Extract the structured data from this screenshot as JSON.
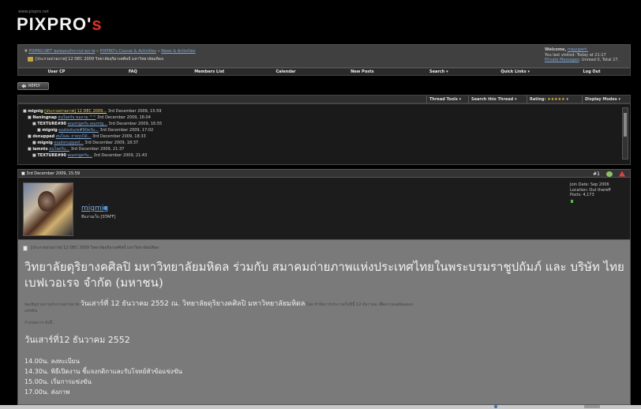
{
  "site": {
    "url": "www.pixpro.net",
    "logo_main": "PIXPRO'",
    "logo_accent": "s"
  },
  "breadcrumb": {
    "lead_symbol": "▼",
    "items": [
      "PIXPRO.NET ชุมชนคนรักการถ่ายภาพ",
      "PIXPRO's Course & Activities",
      "News & Activities"
    ],
    "separator": "»",
    "current": "[ประกวดถ่ายภาพ] 12 DEC 2009 วิทยาลัยดุริยางคศิลป์ มหาวิทยาลัยมหิดล"
  },
  "welcome": {
    "prefix": "Welcome,",
    "username": "mayupert.",
    "last_visited": "You last visited: Today at 21:17",
    "pm_link": "Private Messages",
    "pm_counts": ": Unread 0, Total 27."
  },
  "navbar": [
    "User CP",
    "FAQ",
    "Members List",
    "Calendar",
    "New Posts",
    "Search ▾",
    "Quick Links ▾",
    "Log Out"
  ],
  "reply_button": "REPLY",
  "thread_tools": {
    "tools": "Thread Tools ▾",
    "search": "Search this Thread ▾",
    "rating_label": "Rating:",
    "rating_stars": "★★★★★",
    "rating_caret": "▾",
    "display": "Display Modes ▾"
  },
  "thread_tree": [
    {
      "user": "mignig",
      "link": "[ประกวดถ่ายภาพ] 12 DEC 2009...",
      "date": "3rd December 2009, 15:59"
    },
    {
      "user": "Naningnap",
      "link": "สนใจครับ ขอถาม ^^",
      "date": "3rd December 2009, 16:04"
    },
    {
      "user": "TEXTURE#90",
      "link": "คุณmigครับ คุณmig...",
      "date": "3rd December 2009, 16:55"
    },
    {
      "user": "mignig",
      "link": "คุณtexture#90ครับ...",
      "date": "3rd December 2009, 17:02"
    },
    {
      "user": "dsnupped",
      "link": "สนใจค่ะ ถ่ายรูปได้...",
      "date": "3rd December 2009, 18:33"
    },
    {
      "user": "mignig",
      "link": "คุณdsnupped...",
      "date": "3rd December 2009, 18:37"
    },
    {
      "user": "iamnts",
      "link": "สนใจครับ...",
      "date": "3rd December 2009, 21:37"
    },
    {
      "user": "TEXTURE#90",
      "link": "คุณmigครับ...",
      "date": "3rd December 2009, 21:43"
    }
  ],
  "post": {
    "date": "3rd December 2009, 15:59",
    "number": "#1",
    "username": "migmig",
    "usertitle": "ทีมงานเว็บ [STAFF]",
    "join_date": "Join Date: Sep 2006",
    "location": "Location: Out thereff",
    "posts": "Posts: 4,173",
    "title": "[ประกวดถ่ายภาพ] 12 DEC 2009 วิทยาลัยดุริยางคศิลป์ มหาวิทยาลัยมหิดล",
    "heading": "วิทยาลัยดุริยางคศิลปิ มหาวิทยาลัยมหิดล ร่วมกับ สมาคมถ่ายภาพแห่งประเทศไทยในพระบรมราชูปถัมภ์ และ บริษัท ไทย เบฟเวอเรจ จำกัด (มหาชน)",
    "invite_prefix": "ขอเชิญร่วมงานประกวดถ่ายภาพ",
    "invite_big": "วันเสาร์ที่ 12 ธันวาคม 2552 ณ. วิทยาลัยดุริยางคศิลปิ มหาวิทยาลัยมหิดล",
    "invite_suffix": "โดย หัวข้อการประกวดในปีนี้ 12 ธันวาคม เพื่อความเฉลิมฉลอง",
    "invite_line2": "แข่งขัน",
    "schedule_label": "กำหนดการ ดังนี้",
    "date_heading": "วันเสาร์ที่12 ธันวาคม 2552",
    "schedule": [
      "14.00น. ลงทะเบียน",
      "14.30น. พิธีเปิดงาน ชี้แจงกติกาและรับโจทย์หัวข้อแข่งขัน",
      "15.00น. เริ่มการแข่งขัน",
      "17.00น. ส่งภาพ"
    ]
  },
  "icons": [
    "folder-icon",
    "reply-arrow-icon",
    "warning-icon",
    "reputation-icon",
    "document-icon",
    "online-status-icon"
  ],
  "colors": {
    "link": "#7fa9d8",
    "logo_accent": "#e03020",
    "stars": "#e8c33a",
    "post_body": "#7a7a7a"
  }
}
